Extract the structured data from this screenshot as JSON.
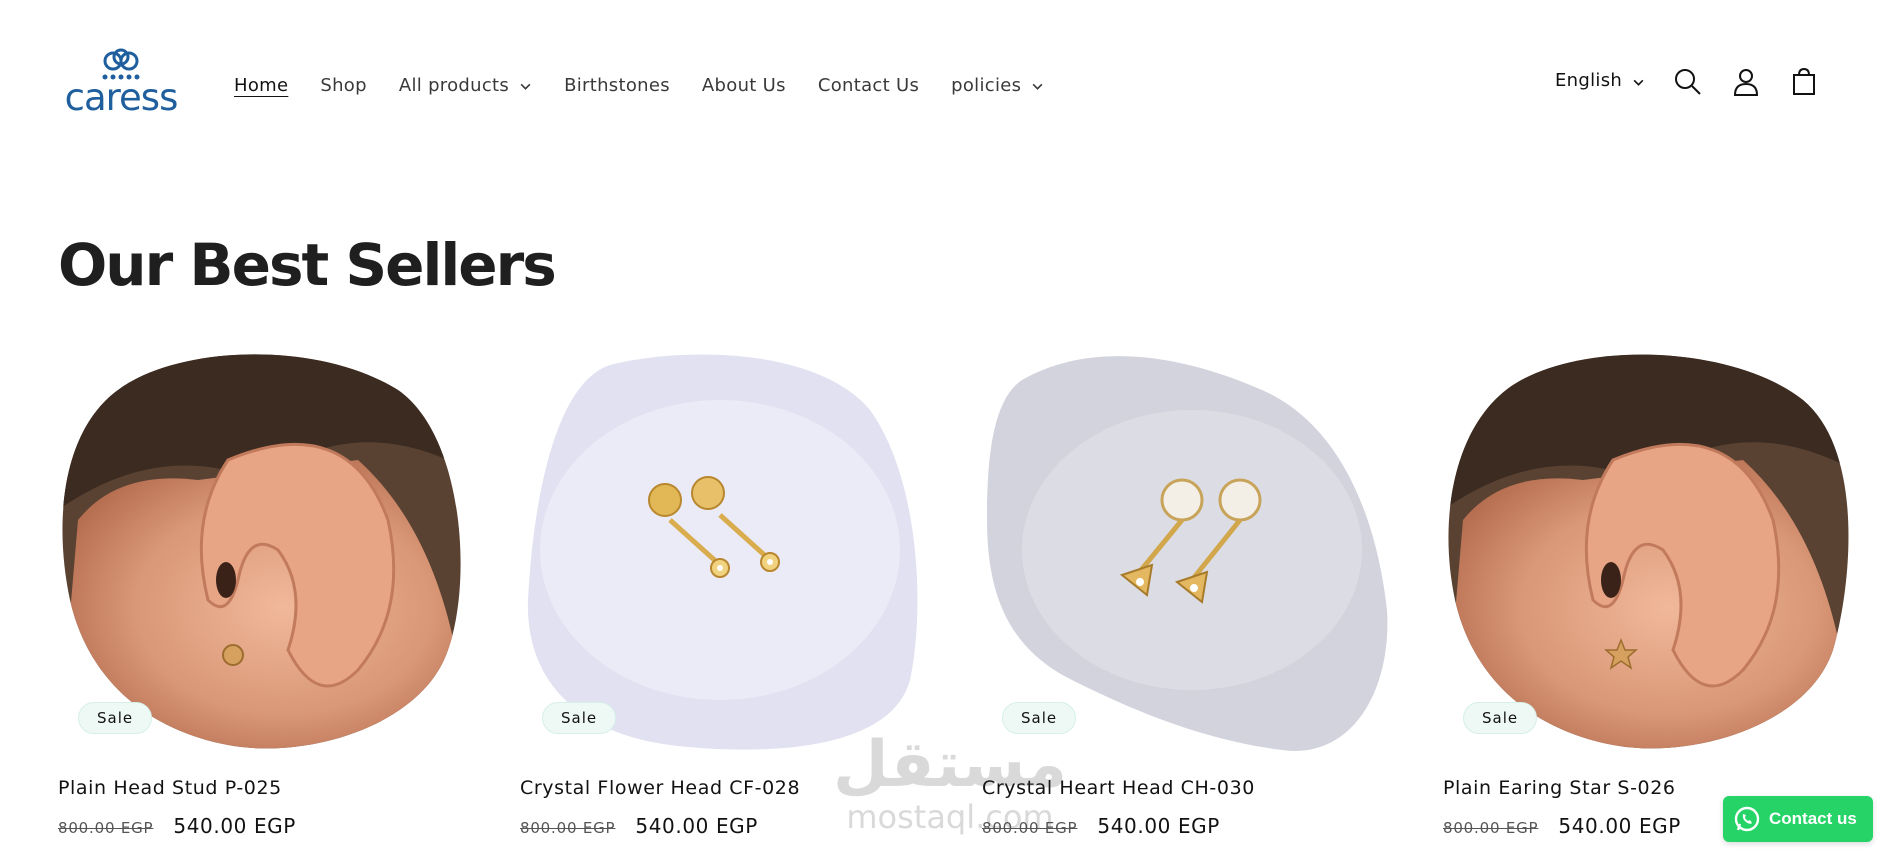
{
  "brand": {
    "name": "caress",
    "primary_color": "#1f5f9e"
  },
  "nav": {
    "items": [
      {
        "label": "Home",
        "active": true,
        "dropdown": false
      },
      {
        "label": "Shop",
        "active": false,
        "dropdown": false
      },
      {
        "label": "All products",
        "active": false,
        "dropdown": true
      },
      {
        "label": "Birthstones",
        "active": false,
        "dropdown": false
      },
      {
        "label": "About Us",
        "active": false,
        "dropdown": false
      },
      {
        "label": "Contact Us",
        "active": false,
        "dropdown": false
      },
      {
        "label": "policies",
        "active": false,
        "dropdown": true
      }
    ]
  },
  "header_actions": {
    "language": "English",
    "icons": [
      "search-icon",
      "account-icon",
      "cart-icon"
    ]
  },
  "section": {
    "title": "Our Best Sellers"
  },
  "products": [
    {
      "title": "Plain Head Stud P-025",
      "old_price": "800.00 EGP",
      "price": "540.00 EGP",
      "badge": "Sale",
      "image": "ear-photo"
    },
    {
      "title": "Crystal Flower Head CF-028",
      "old_price": "800.00 EGP",
      "price": "540.00 EGP",
      "badge": "Sale",
      "image": "studs-photo"
    },
    {
      "title": "Crystal Heart Head CH-030",
      "old_price": "800.00 EGP",
      "price": "540.00 EGP",
      "badge": "Sale",
      "image": "studs-photo"
    },
    {
      "title": "Plain Earing Star S-026",
      "old_price": "800.00 EGP",
      "price": "540.00 EGP",
      "badge": "Sale",
      "image": "ear-photo"
    }
  ],
  "watermark": {
    "arabic": "مستقل",
    "latin": "mostaql.com"
  },
  "contact_button": {
    "label": "Contact us",
    "color": "#25d366"
  }
}
